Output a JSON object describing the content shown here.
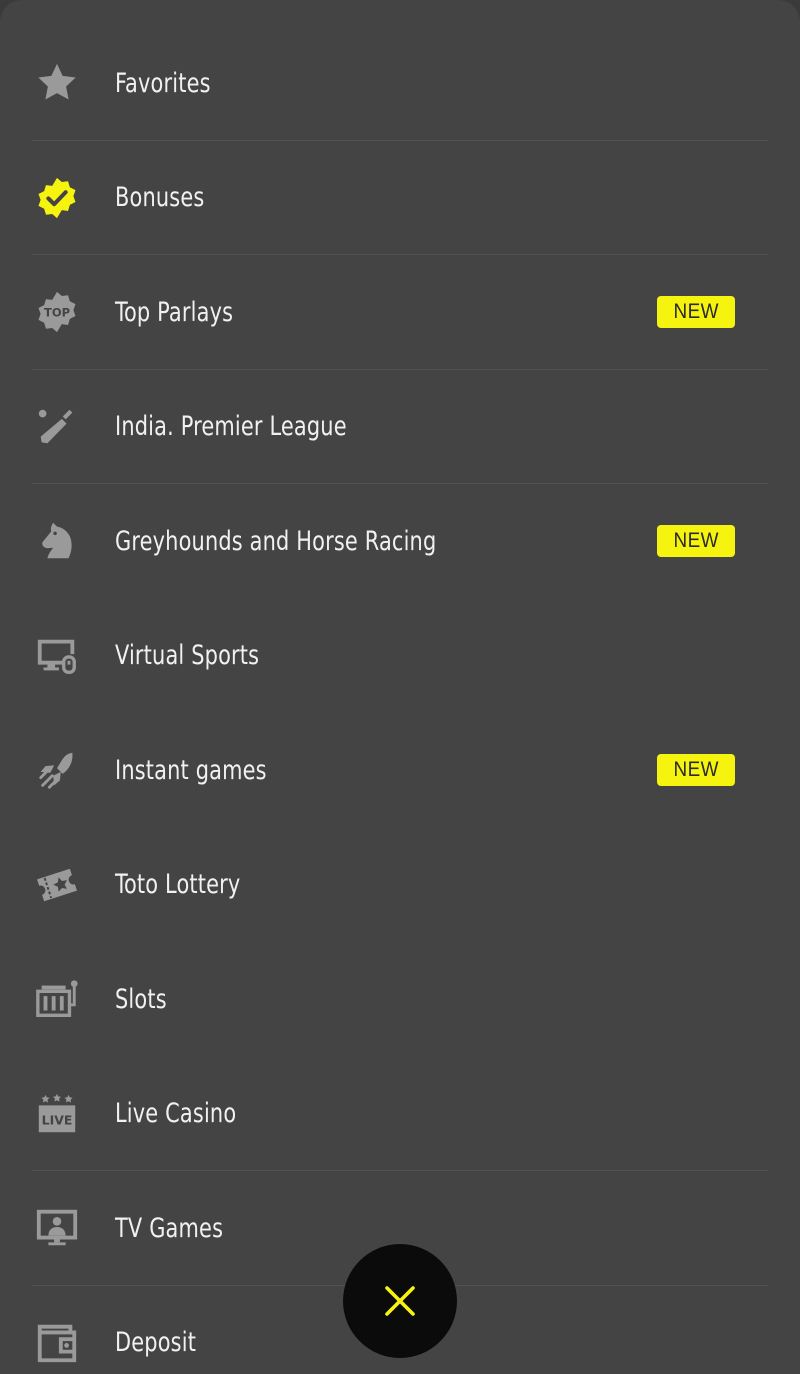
{
  "menu": {
    "items": [
      {
        "label": "Favorites",
        "icon": "star-icon",
        "badge": ""
      },
      {
        "label": "Bonuses",
        "icon": "verified-badge-icon",
        "badge": ""
      },
      {
        "label": "Top Parlays",
        "icon": "top-seal-icon",
        "badge": "NEW",
        "icon_text": "TOP"
      },
      {
        "label": "India. Premier League",
        "icon": "cricket-bat-icon",
        "badge": ""
      },
      {
        "label": "Greyhounds and Horse Racing",
        "icon": "horse-head-icon",
        "badge": "NEW"
      },
      {
        "label": "Virtual Sports",
        "icon": "monitor-joystick-icon",
        "badge": ""
      },
      {
        "label": "Instant games",
        "icon": "rocket-icon",
        "badge": "NEW"
      },
      {
        "label": "Toto Lottery",
        "icon": "lottery-ticket-icon",
        "badge": ""
      },
      {
        "label": "Slots",
        "icon": "slot-machine-icon",
        "badge": ""
      },
      {
        "label": "Live Casino",
        "icon": "live-sign-icon",
        "badge": "",
        "icon_text": "LIVE"
      },
      {
        "label": "TV Games",
        "icon": "tv-presenter-icon",
        "badge": ""
      },
      {
        "label": "Deposit",
        "icon": "wallet-icon",
        "badge": ""
      }
    ]
  },
  "colors": {
    "background": "#444444",
    "accent": "#f6f40e",
    "icon_gray": "#9a9a9a",
    "text": "#f1f1f1",
    "close_button": "#0b0b0b"
  },
  "close_button": {
    "icon": "close-icon"
  }
}
